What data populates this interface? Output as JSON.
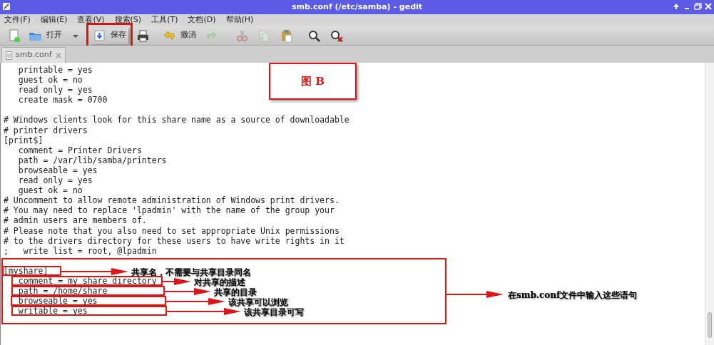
{
  "window": {
    "title": "smb.conf (/etc/samba) - gedit"
  },
  "menu": [
    "文件(F)",
    "编辑(E)",
    "查看(V)",
    "搜索(S)",
    "工具(T)",
    "文档(D)",
    "帮助(H)"
  ],
  "toolbar": [
    {
      "kind": "new",
      "disabled": false,
      "highlighted": false
    },
    {
      "kind": "open",
      "label": "打开",
      "disabled": false,
      "highlighted": false
    },
    {
      "kind": "dropdown",
      "disabled": false,
      "highlighted": false
    },
    {
      "kind": "save",
      "label": "保存",
      "disabled": false,
      "highlighted": true
    },
    {
      "kind": "print",
      "disabled": false,
      "highlighted": false
    },
    {
      "kind": "undo",
      "label": "撤消",
      "disabled": false,
      "highlighted": false
    },
    {
      "kind": "redo",
      "disabled": true,
      "highlighted": false
    },
    {
      "kind": "cut",
      "disabled": true,
      "highlighted": false
    },
    {
      "kind": "copy",
      "disabled": true,
      "highlighted": false
    },
    {
      "kind": "paste",
      "disabled": false,
      "highlighted": false
    },
    {
      "kind": "search",
      "disabled": false,
      "highlighted": false
    },
    {
      "kind": "replace",
      "disabled": false,
      "highlighted": false
    }
  ],
  "tabs": [
    {
      "label": "smb.conf",
      "selected": true
    }
  ],
  "editor": {
    "blocks": [
      [
        "   printable = yes",
        "   guest ok = no",
        "   read only = yes",
        "   create mask = 0700"
      ],
      [
        "# Windows clients look for this share name as a source of downloadable",
        "# printer drivers",
        "[print$]",
        "   comment = Printer Drivers",
        "   path = /var/lib/samba/printers",
        "   browseable = yes",
        "   read only = yes",
        "   guest ok = no",
        "# Uncomment to allow remote administration of Windows print drivers.",
        "# You may need to replace 'lpadmin' with the name of the group your",
        "# admin users are members of.",
        "# Please note that you also need to set appropriate Unix permissions",
        "# to the drivers directory for these users to have write rights in it",
        ";   write list = root, @lpadmin"
      ],
      [
        "[myshare]",
        "   comment = my share directory",
        "   path = /home/share",
        "   browseable = yes",
        "   writable = yes"
      ]
    ]
  },
  "annotations": {
    "figure_label": "图 B",
    "callouts": [
      "共享名，不需要与共享目录同名",
      "对共享的描述",
      "共享的目录",
      "该共享可以浏览",
      "该共享目录可写"
    ],
    "summary": "在smb.conf文件中输入这些语句"
  }
}
